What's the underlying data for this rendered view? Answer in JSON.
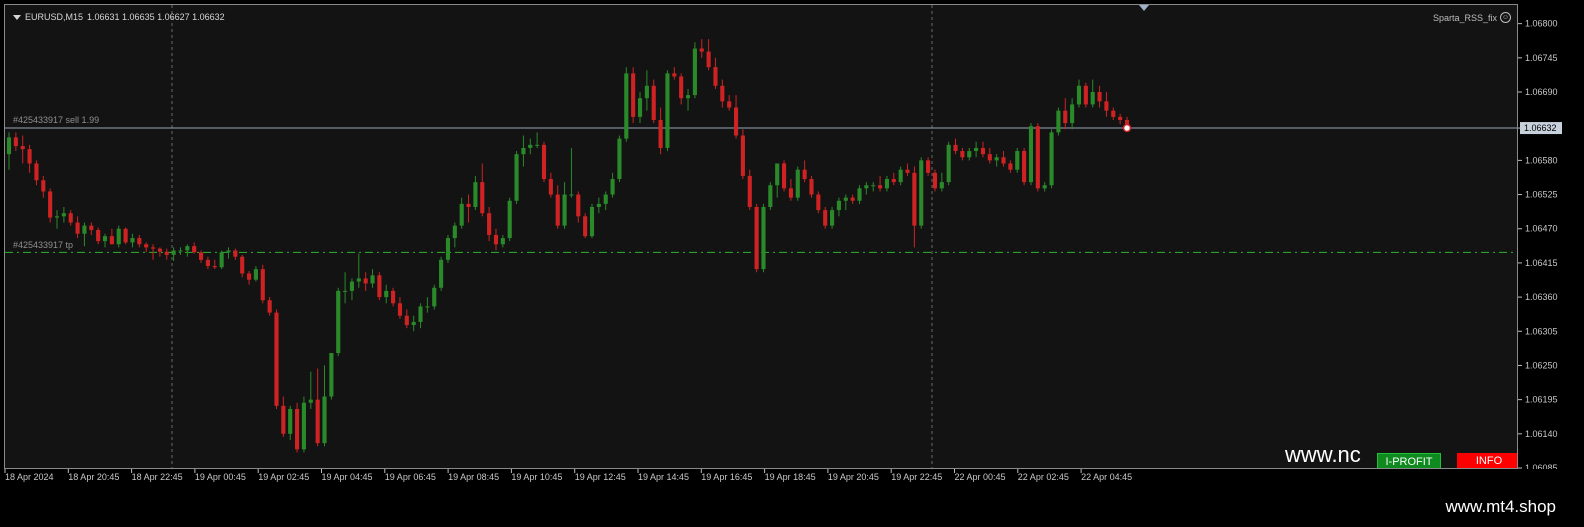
{
  "header": {
    "symbol": "EURUSD,M15",
    "ohlc": "1.06631 1.06635 1.06627 1.06632",
    "indicator_name": "Sparta_RSS_fix"
  },
  "orders": {
    "sell_label": "#425433917 sell 1.99",
    "sell_price": 1.06632,
    "tp_label": "#425433917 tp",
    "tp_price": 1.06432
  },
  "current_price_label": "1.06632",
  "price_axis": {
    "ticks": [
      "1.06800",
      "1.06745",
      "1.06690",
      "1.06632",
      "1.06580",
      "1.06525",
      "1.06470",
      "1.06415",
      "1.06360",
      "1.06305",
      "1.06250",
      "1.06195",
      "1.06140",
      "1.06085"
    ]
  },
  "time_axis": {
    "labels": [
      "18 Apr 2024",
      "18 Apr 20:45",
      "18 Apr 22:45",
      "19 Apr 00:45",
      "19 Apr 02:45",
      "19 Apr 04:45",
      "19 Apr 06:45",
      "19 Apr 08:45",
      "19 Apr 10:45",
      "19 Apr 12:45",
      "19 Apr 14:45",
      "19 Apr 16:45",
      "19 Apr 18:45",
      "19 Apr 20:45",
      "19 Apr 22:45",
      "22 Apr 00:45",
      "22 Apr 02:45",
      "22 Apr 04:45"
    ]
  },
  "chart_data": {
    "type": "candlestick",
    "symbol": "EURUSD",
    "timeframe": "M15",
    "ylim": [
      1.06085,
      1.0683
    ],
    "bull_color": "#2a8a2a",
    "bear_color": "#cf2323",
    "grid": false,
    "candles": [
      [
        1.0659,
        1.06625,
        1.06565,
        1.06617
      ],
      [
        1.06617,
        1.06625,
        1.06595,
        1.06603
      ],
      [
        1.06603,
        1.0662,
        1.06575,
        1.06598
      ],
      [
        1.06598,
        1.06605,
        1.0656,
        1.06575
      ],
      [
        1.06575,
        1.0658,
        1.0654,
        1.06548
      ],
      [
        1.06548,
        1.06555,
        1.0652,
        1.0653
      ],
      [
        1.0653,
        1.06535,
        1.0648,
        1.06488
      ],
      [
        1.06488,
        1.065,
        1.0647,
        1.0649
      ],
      [
        1.0649,
        1.06505,
        1.0648,
        1.06495
      ],
      [
        1.06495,
        1.065,
        1.06475,
        1.0648
      ],
      [
        1.0648,
        1.0649,
        1.06455,
        1.06462
      ],
      [
        1.06462,
        1.0648,
        1.06442,
        1.06475
      ],
      [
        1.06475,
        1.0648,
        1.0646,
        1.06468
      ],
      [
        1.06468,
        1.06472,
        1.06445,
        1.0645
      ],
      [
        1.0645,
        1.06462,
        1.0644,
        1.06458
      ],
      [
        1.06458,
        1.0647,
        1.06445,
        1.06445
      ],
      [
        1.06445,
        1.06475,
        1.0644,
        1.0647
      ],
      [
        1.0647,
        1.06472,
        1.06445,
        1.06448
      ],
      [
        1.06448,
        1.06462,
        1.0644,
        1.06455
      ],
      [
        1.06455,
        1.0646,
        1.0644,
        1.06445
      ],
      [
        1.06445,
        1.06448,
        1.06432,
        1.0644
      ],
      [
        1.0644,
        1.06445,
        1.0642,
        1.06438
      ],
      [
        1.06438,
        1.0644,
        1.06425,
        1.06433
      ],
      [
        1.06433,
        1.06438,
        1.0642,
        1.06428
      ],
      [
        1.06428,
        1.0644,
        1.06418,
        1.06435
      ],
      [
        1.06435,
        1.0644,
        1.06428,
        1.06435
      ],
      [
        1.06435,
        1.06445,
        1.06425,
        1.06442
      ],
      [
        1.06442,
        1.06448,
        1.0643,
        1.06432
      ],
      [
        1.06432,
        1.06435,
        1.06415,
        1.0642
      ],
      [
        1.0642,
        1.06425,
        1.06405,
        1.0641
      ],
      [
        1.0641,
        1.0642,
        1.06405,
        1.06408
      ],
      [
        1.06408,
        1.06435,
        1.06405,
        1.06432
      ],
      [
        1.06432,
        1.0644,
        1.06422,
        1.06435
      ],
      [
        1.06435,
        1.06438,
        1.0642,
        1.06425
      ],
      [
        1.06425,
        1.06428,
        1.06392,
        1.06398
      ],
      [
        1.06398,
        1.06402,
        1.0638,
        1.06388
      ],
      [
        1.06388,
        1.0641,
        1.06385,
        1.06405
      ],
      [
        1.06405,
        1.06412,
        1.0635,
        1.06355
      ],
      [
        1.06355,
        1.0636,
        1.0633,
        1.06335
      ],
      [
        1.06335,
        1.0634,
        1.0618,
        1.06185
      ],
      [
        1.06185,
        1.062,
        1.06135,
        1.0614
      ],
      [
        1.0614,
        1.06185,
        1.0613,
        1.0618
      ],
      [
        1.0618,
        1.0619,
        1.0611,
        1.06115
      ],
      [
        1.06115,
        1.062,
        1.0611,
        1.0619
      ],
      [
        1.0619,
        1.0624,
        1.0618,
        1.06195
      ],
      [
        1.06195,
        1.06245,
        1.0612,
        1.06125
      ],
      [
        1.06125,
        1.0625,
        1.0612,
        1.062
      ],
      [
        1.062,
        1.0627,
        1.06195,
        1.0627
      ],
      [
        1.0627,
        1.06375,
        1.06265,
        1.0637
      ],
      [
        1.0637,
        1.064,
        1.0635,
        1.0637
      ],
      [
        1.0637,
        1.0639,
        1.06355,
        1.06385
      ],
      [
        1.06385,
        1.0643,
        1.06375,
        1.0639
      ],
      [
        1.0639,
        1.064,
        1.0637,
        1.06382
      ],
      [
        1.06382,
        1.06405,
        1.06375,
        1.06395
      ],
      [
        1.06395,
        1.064,
        1.06355,
        1.0636
      ],
      [
        1.0636,
        1.0638,
        1.0635,
        1.0637
      ],
      [
        1.0637,
        1.06375,
        1.06345,
        1.0635
      ],
      [
        1.0635,
        1.0636,
        1.06325,
        1.0633
      ],
      [
        1.0633,
        1.0634,
        1.0631,
        1.06315
      ],
      [
        1.06315,
        1.0633,
        1.06305,
        1.0632
      ],
      [
        1.0632,
        1.0635,
        1.0631,
        1.06345
      ],
      [
        1.06345,
        1.0636,
        1.06335,
        1.06345
      ],
      [
        1.06345,
        1.0638,
        1.0634,
        1.06375
      ],
      [
        1.06375,
        1.06425,
        1.0637,
        1.0642
      ],
      [
        1.0642,
        1.0646,
        1.06415,
        1.06455
      ],
      [
        1.06455,
        1.0648,
        1.0644,
        1.06475
      ],
      [
        1.06475,
        1.0652,
        1.0647,
        1.0651
      ],
      [
        1.0651,
        1.06525,
        1.0648,
        1.06505
      ],
      [
        1.06505,
        1.06555,
        1.065,
        1.06545
      ],
      [
        1.06545,
        1.06575,
        1.0649,
        1.06495
      ],
      [
        1.06495,
        1.06505,
        1.0645,
        1.0646
      ],
      [
        1.0646,
        1.0647,
        1.06435,
        1.06445
      ],
      [
        1.06445,
        1.0646,
        1.0644,
        1.06455
      ],
      [
        1.06455,
        1.0652,
        1.0645,
        1.06515
      ],
      [
        1.06515,
        1.06595,
        1.0651,
        1.0659
      ],
      [
        1.0659,
        1.0662,
        1.0657,
        1.066
      ],
      [
        1.066,
        1.06615,
        1.0659,
        1.06605
      ],
      [
        1.06605,
        1.06625,
        1.066,
        1.06605
      ],
      [
        1.06605,
        1.0661,
        1.06545,
        1.0655
      ],
      [
        1.0655,
        1.0656,
        1.0652,
        1.06525
      ],
      [
        1.06525,
        1.0654,
        1.0647,
        1.06475
      ],
      [
        1.06475,
        1.06545,
        1.0647,
        1.06525
      ],
      [
        1.06525,
        1.066,
        1.0652,
        1.06525
      ],
      [
        1.06525,
        1.0653,
        1.0648,
        1.0649
      ],
      [
        1.0649,
        1.06495,
        1.06455,
        1.06458
      ],
      [
        1.06458,
        1.0651,
        1.06455,
        1.06505
      ],
      [
        1.06505,
        1.0652,
        1.06495,
        1.0651
      ],
      [
        1.0651,
        1.0653,
        1.065,
        1.06525
      ],
      [
        1.06525,
        1.0656,
        1.0652,
        1.0655
      ],
      [
        1.0655,
        1.0662,
        1.06545,
        1.06615
      ],
      [
        1.06615,
        1.0673,
        1.0661,
        1.0672
      ],
      [
        1.0672,
        1.0673,
        1.0664,
        1.0665
      ],
      [
        1.0665,
        1.0669,
        1.0664,
        1.0668
      ],
      [
        1.0668,
        1.06725,
        1.0666,
        1.067
      ],
      [
        1.067,
        1.0671,
        1.0664,
        1.06645
      ],
      [
        1.06645,
        1.06665,
        1.0659,
        1.066
      ],
      [
        1.066,
        1.06725,
        1.06595,
        1.0672
      ],
      [
        1.0672,
        1.0673,
        1.0671,
        1.06715
      ],
      [
        1.06715,
        1.0672,
        1.0667,
        1.0668
      ],
      [
        1.0668,
        1.06695,
        1.0666,
        1.06685
      ],
      [
        1.06685,
        1.0677,
        1.0668,
        1.0676
      ],
      [
        1.0676,
        1.06775,
        1.06745,
        1.06755
      ],
      [
        1.06755,
        1.06775,
        1.06725,
        1.0673
      ],
      [
        1.0673,
        1.06745,
        1.06695,
        1.067
      ],
      [
        1.067,
        1.0671,
        1.06665,
        1.06675
      ],
      [
        1.06675,
        1.06685,
        1.0666,
        1.06665
      ],
      [
        1.06665,
        1.06685,
        1.06615,
        1.0662
      ],
      [
        1.0662,
        1.0663,
        1.0655,
        1.06555
      ],
      [
        1.06555,
        1.06565,
        1.065,
        1.06505
      ],
      [
        1.06505,
        1.0651,
        1.064,
        1.06405
      ],
      [
        1.06405,
        1.0651,
        1.064,
        1.06505
      ],
      [
        1.06505,
        1.06545,
        1.065,
        1.0654
      ],
      [
        1.0654,
        1.06565,
        1.0652,
        1.06575
      ],
      [
        1.06575,
        1.0658,
        1.0653,
        1.06535
      ],
      [
        1.06535,
        1.0655,
        1.06515,
        1.0652
      ],
      [
        1.0652,
        1.0657,
        1.06515,
        1.06565
      ],
      [
        1.06565,
        1.0658,
        1.06545,
        1.0655
      ],
      [
        1.0655,
        1.06555,
        1.0652,
        1.06525
      ],
      [
        1.06525,
        1.0653,
        1.06495,
        1.065
      ],
      [
        1.065,
        1.06505,
        1.0647,
        1.06475
      ],
      [
        1.06475,
        1.06505,
        1.0647,
        1.065
      ],
      [
        1.065,
        1.0652,
        1.0649,
        1.06515
      ],
      [
        1.06515,
        1.06525,
        1.065,
        1.0652
      ],
      [
        1.0652,
        1.06525,
        1.0651,
        1.06515
      ],
      [
        1.06515,
        1.0654,
        1.0651,
        1.06535
      ],
      [
        1.06535,
        1.06545,
        1.06525,
        1.0654
      ],
      [
        1.0654,
        1.06545,
        1.0653,
        1.0654
      ],
      [
        1.0654,
        1.06555,
        1.0653,
        1.06535
      ],
      [
        1.06535,
        1.06555,
        1.0653,
        1.0655
      ],
      [
        1.0655,
        1.0656,
        1.0654,
        1.06545
      ],
      [
        1.06545,
        1.0657,
        1.0654,
        1.06565
      ],
      [
        1.06565,
        1.06575,
        1.06555,
        1.0656
      ],
      [
        1.0656,
        1.0657,
        1.0644,
        1.06475
      ],
      [
        1.06475,
        1.06585,
        1.0647,
        1.0658
      ],
      [
        1.0658,
        1.06585,
        1.06555,
        1.0656
      ],
      [
        1.0656,
        1.06565,
        1.0653,
        1.06535
      ],
      [
        1.06535,
        1.0656,
        1.0653,
        1.06545
      ],
      [
        1.06545,
        1.0661,
        1.0654,
        1.06605
      ],
      [
        1.06605,
        1.06615,
        1.0659,
        1.06595
      ],
      [
        1.06595,
        1.066,
        1.0658,
        1.06585
      ],
      [
        1.06585,
        1.066,
        1.0658,
        1.06595
      ],
      [
        1.06595,
        1.0661,
        1.06585,
        1.066
      ],
      [
        1.066,
        1.0661,
        1.06585,
        1.0659
      ],
      [
        1.0659,
        1.066,
        1.06575,
        1.0658
      ],
      [
        1.0658,
        1.0659,
        1.0657,
        1.06585
      ],
      [
        1.06585,
        1.06595,
        1.0657,
        1.06575
      ],
      [
        1.06575,
        1.0658,
        1.0656,
        1.06565
      ],
      [
        1.06565,
        1.066,
        1.0656,
        1.06595
      ],
      [
        1.06595,
        1.066,
        1.0654,
        1.06545
      ],
      [
        1.06545,
        1.0664,
        1.0654,
        1.06635
      ],
      [
        1.06635,
        1.0664,
        1.0653,
        1.06535
      ],
      [
        1.06535,
        1.06545,
        1.0653,
        1.0654
      ],
      [
        1.0654,
        1.0663,
        1.06535,
        1.06625
      ],
      [
        1.06625,
        1.06665,
        1.0662,
        1.0666
      ],
      [
        1.0666,
        1.0668,
        1.0663,
        1.0664
      ],
      [
        1.0664,
        1.0668,
        1.0663,
        1.0667
      ],
      [
        1.0667,
        1.0671,
        1.06665,
        1.067
      ],
      [
        1.067,
        1.06705,
        1.06665,
        1.0667
      ],
      [
        1.0667,
        1.0671,
        1.06665,
        1.0669
      ],
      [
        1.0669,
        1.067,
        1.06665,
        1.06675
      ],
      [
        1.06675,
        1.0669,
        1.0665,
        1.0666
      ],
      [
        1.0666,
        1.06665,
        1.06645,
        1.0665
      ],
      [
        1.0665,
        1.06655,
        1.06638,
        1.06645
      ],
      [
        1.06645,
        1.0665,
        1.0663,
        1.06632
      ]
    ]
  }
}
